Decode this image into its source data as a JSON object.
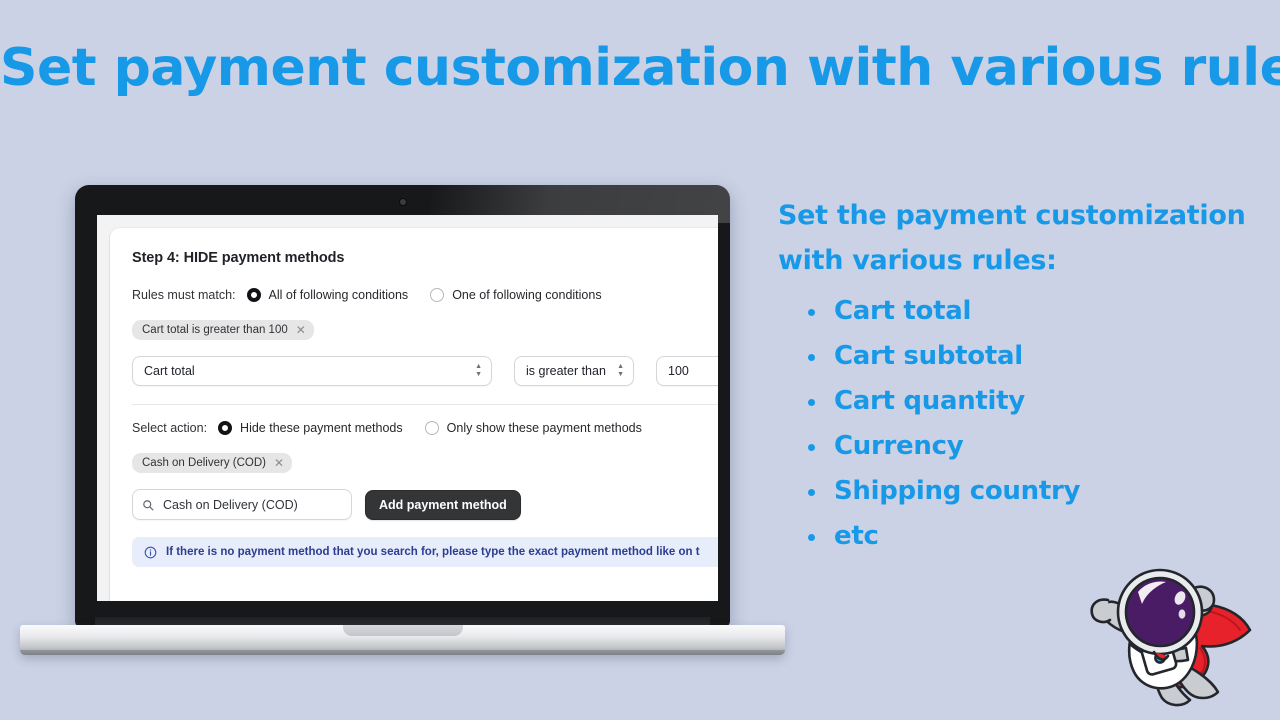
{
  "hero": {
    "title": "Set payment customization with various rules"
  },
  "laptop": {
    "screen": {
      "card": {
        "title": "Step 4: HIDE payment methods",
        "rules_match": {
          "label": "Rules must match:",
          "options": [
            {
              "label": "All of following conditions",
              "selected": true
            },
            {
              "label": "One of following conditions",
              "selected": false
            }
          ]
        },
        "condition_chip": {
          "label": "Cart total is greater than 100",
          "remove_icon": "close-icon"
        },
        "condition_row": {
          "field": "Cart total",
          "operator": "is greater than",
          "value": "100"
        },
        "select_action": {
          "label": "Select action:",
          "options": [
            {
              "label": "Hide these payment methods",
              "selected": true
            },
            {
              "label": "Only show these payment methods",
              "selected": false
            }
          ]
        },
        "method_chip": {
          "label": "Cash on Delivery (COD)",
          "remove_icon": "close-icon"
        },
        "search": {
          "value": "Cash on Delivery (COD)",
          "icon": "search-icon"
        },
        "add_button": "Add payment method",
        "banner": {
          "icon": "info-icon",
          "text": "If there is no payment method that you search for, please type the exact payment method like on t"
        }
      }
    }
  },
  "right": {
    "heading_line1": "Set the payment customization",
    "heading_line2": "with various rules:",
    "bullets": [
      "Cart total",
      "Cart subtotal",
      "Cart quantity",
      "Currency",
      "Shipping country",
      "etc"
    ]
  },
  "mascot": {
    "name": "astronaut-mascot"
  },
  "colors": {
    "background": "#cbd2e6",
    "accent_blue": "#1899e8",
    "banner_bg": "#e7edfb",
    "banner_text": "#2c3e8f",
    "button_dark": "#343536"
  }
}
